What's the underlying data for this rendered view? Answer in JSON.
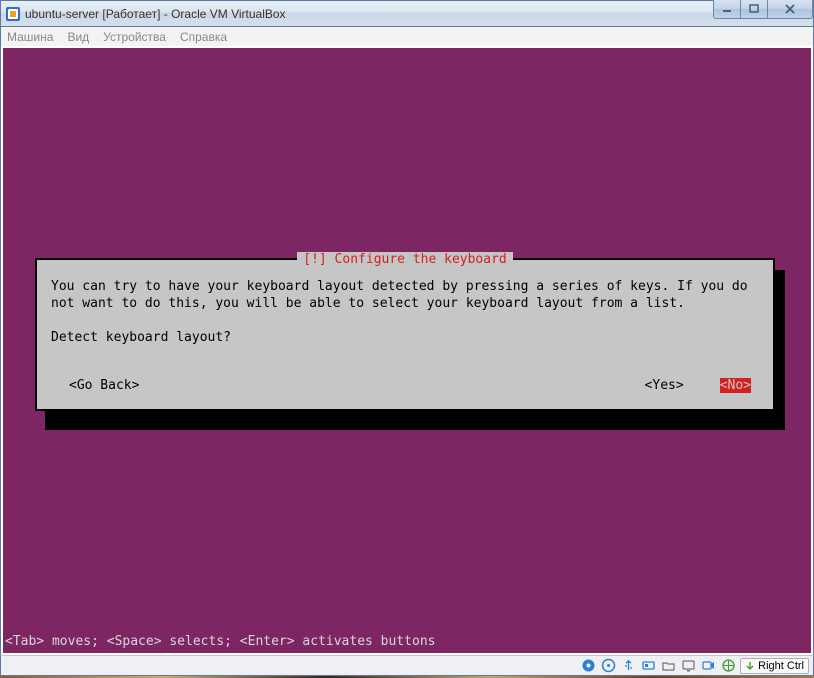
{
  "window": {
    "title": "ubuntu-server [Работает] - Oracle VM VirtualBox"
  },
  "menu": {
    "items": [
      "Машина",
      "Вид",
      "Устройства",
      "Справка"
    ]
  },
  "dialog": {
    "title": "[!] Configure the keyboard",
    "body": "You can try to have your keyboard layout detected by pressing a series of keys. If you do not want to do this, you will be able to select your keyboard layout from a list.\n\nDetect keyboard layout?",
    "go_back": "<Go Back>",
    "yes": "<Yes>",
    "no": "<No>"
  },
  "footer_hint": "<Tab> moves; <Space> selects; <Enter> activates buttons",
  "status": {
    "host_key": "Right Ctrl"
  }
}
